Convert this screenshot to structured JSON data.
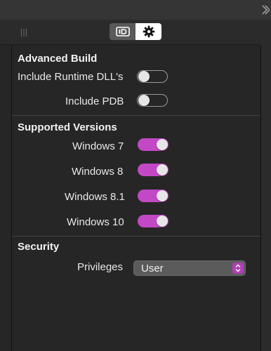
{
  "topbar": {
    "expand_icon": "chevron-right-icon"
  },
  "toolbar": {
    "grip_icon": "grip-icon",
    "identity_icon": "id-card-icon",
    "settings_icon": "gear-icon"
  },
  "sections": {
    "advanced_build": {
      "title": "Advanced Build",
      "runtime_dlls": {
        "label": "Include Runtime DLL's",
        "enabled": false
      },
      "pdb": {
        "label": "Include PDB",
        "enabled": false
      }
    },
    "supported_versions": {
      "title": "Supported Versions",
      "win7": {
        "label": "Windows 7",
        "enabled": true
      },
      "win8": {
        "label": "Windows 8",
        "enabled": true
      },
      "win81": {
        "label": "Windows 8.1",
        "enabled": true
      },
      "win10": {
        "label": "Windows 10",
        "enabled": true
      }
    },
    "security": {
      "title": "Security",
      "privileges": {
        "label": "Privileges",
        "value": "User"
      }
    }
  },
  "colors": {
    "accent": "#c348c6",
    "background": "#262626"
  }
}
